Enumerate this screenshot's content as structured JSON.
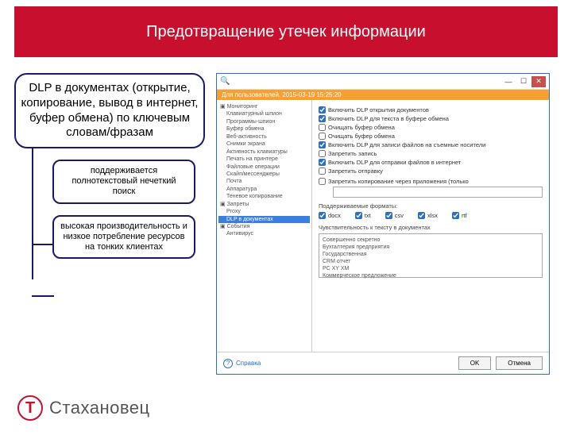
{
  "banner": {
    "title": "Предотвращение утечек информации"
  },
  "diagram": {
    "main": "DLP в документах (открытие, копирование, вывод в интернет, буфер обмена) по ключевым словам/фразам",
    "sub1": "поддерживается полнотекстовый нечеткий поиск",
    "sub2": "высокая производительность и низкое потребление ресурсов на тонких клиентах"
  },
  "window": {
    "header": "Для пользователей. 2015-03-19 15:25:20",
    "tree": {
      "root": "Мониторинг",
      "items": [
        "Клавиатурный шпион",
        "Программы-шпион",
        "Буфер обмена",
        "Веб-активность",
        "Снимки экрана",
        "Активность клавиатуры",
        "Печать на принтере",
        "Файловые операции",
        "Скайп/мессенджеры",
        "Почта",
        "Аппаратура",
        "Теневое копирование"
      ],
      "group2": "Запреты",
      "group2items": [
        "Proxy"
      ],
      "selected": "DLP в документах",
      "group3": "События",
      "group3items": [
        "Антивирус"
      ]
    },
    "settings": {
      "c1": "Включить DLP открытия документов",
      "c2": "Включить DLP для текста в буфере обмена",
      "c2a": "Очищать буфер обмена",
      "c2b": "Очищать буфер обмена",
      "c3": "Включить DLP для записи файлов на съемные носители",
      "c3a": "Запретить запись",
      "c4": "Включить DLP для отправки файлов в интернет",
      "c4a": "Запретить отправку",
      "c5": "Запретить копирование через приложения (только",
      "c5field_label": "",
      "formats_label": "Поддерживаемые форматы:",
      "formats": [
        "docx",
        "txt",
        "csv",
        "xlsx",
        "rtf"
      ],
      "sens_label": "Чувствительность к тексту в документах",
      "sens_items": [
        "Совершенно секретно",
        "Бухгалтерия предприятия",
        "Государственная",
        "CRM отчет",
        "PC XY XM",
        "Коммерческое предложение"
      ]
    },
    "footer": {
      "help": "Справка",
      "ok": "OK",
      "cancel": "Отмена"
    }
  },
  "logo": {
    "text": "Стахановец",
    "mark": "Т"
  }
}
